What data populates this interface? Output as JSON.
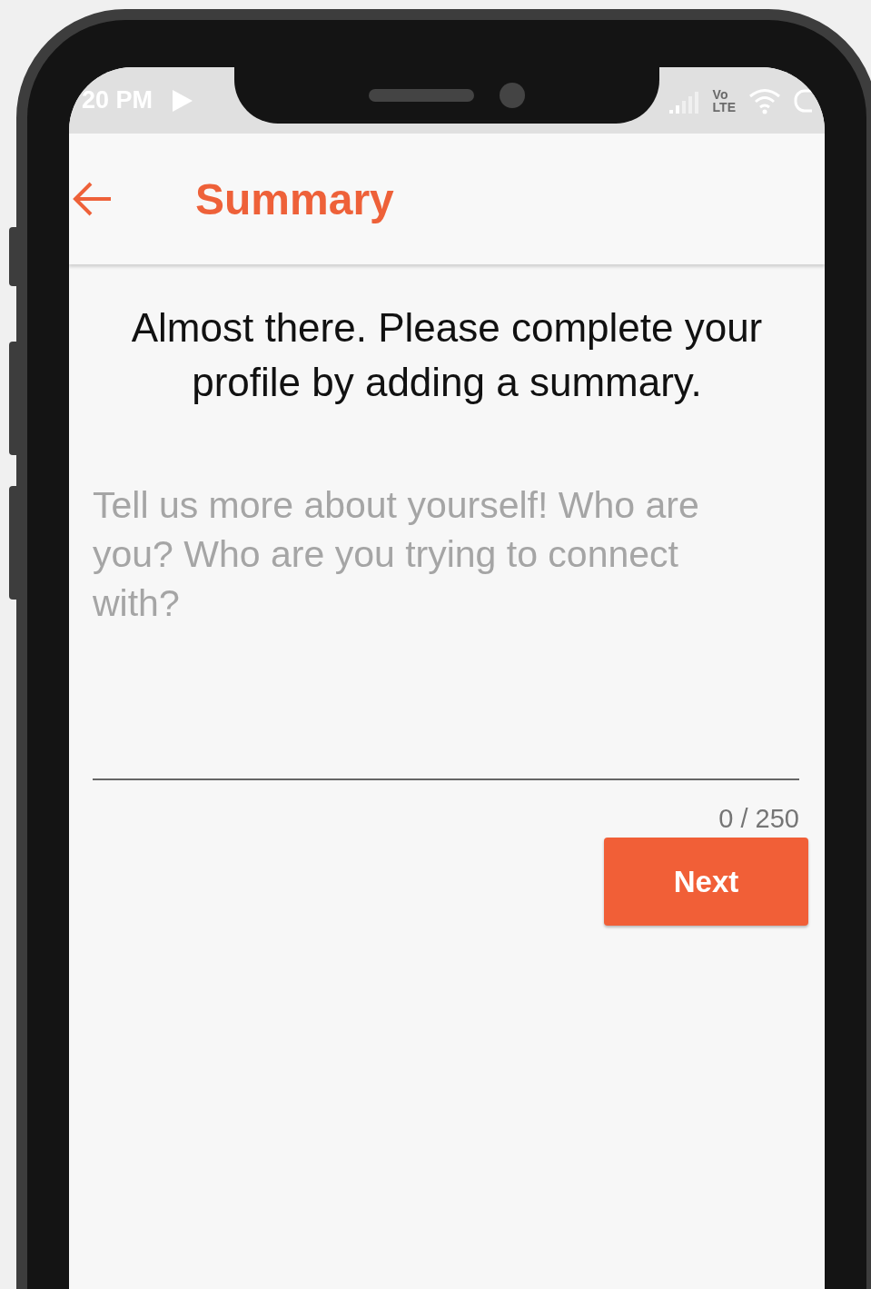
{
  "status_bar": {
    "time": "20 PM",
    "network": [
      "Vo",
      "LTE"
    ]
  },
  "app_bar": {
    "title": "Summary"
  },
  "heading": "Almost there. Please complete your profile by adding a summary.",
  "summary_field": {
    "placeholder": "Tell us more about yourself! Who are you? Who are you trying to connect with?",
    "counter": "0 / 250"
  },
  "buttons": [
    {
      "label": "Next",
      "kind": "primary"
    }
  ]
}
